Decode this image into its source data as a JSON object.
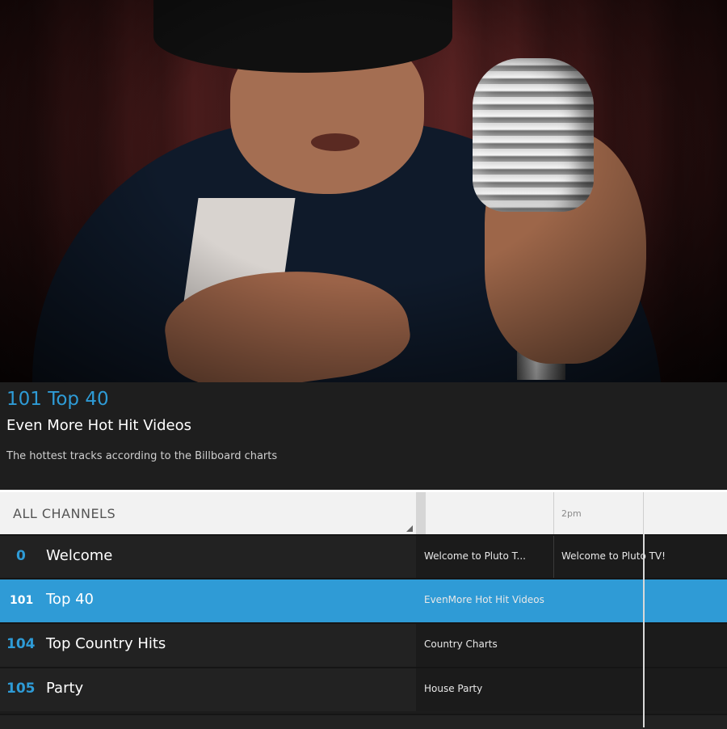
{
  "now_playing": {
    "title": "101 Top 40",
    "subtitle": "Even More Hot Hit Videos",
    "description": "The hottest tracks according to the Billboard charts"
  },
  "guide": {
    "filter_label": "ALL CHANNELS",
    "time_label": "2pm",
    "channels": [
      {
        "number": "0",
        "name": "Welcome",
        "programs": [
          "Welcome to Pluto T...",
          "Welcome to Pluto TV!"
        ],
        "selected": false
      },
      {
        "number": "101",
        "name": "Top 40",
        "programs": [
          "EvenMore Hot Hit Videos"
        ],
        "selected": true
      },
      {
        "number": "104",
        "name": "Top Country Hits",
        "programs": [
          "Country Charts"
        ],
        "selected": false
      },
      {
        "number": "105",
        "name": "Party",
        "programs": [
          "House Party"
        ],
        "selected": false
      }
    ]
  },
  "colors": {
    "accent": "#2e9bd6",
    "selected_row": "#2f9bd6",
    "background": "#1c1c1c"
  }
}
